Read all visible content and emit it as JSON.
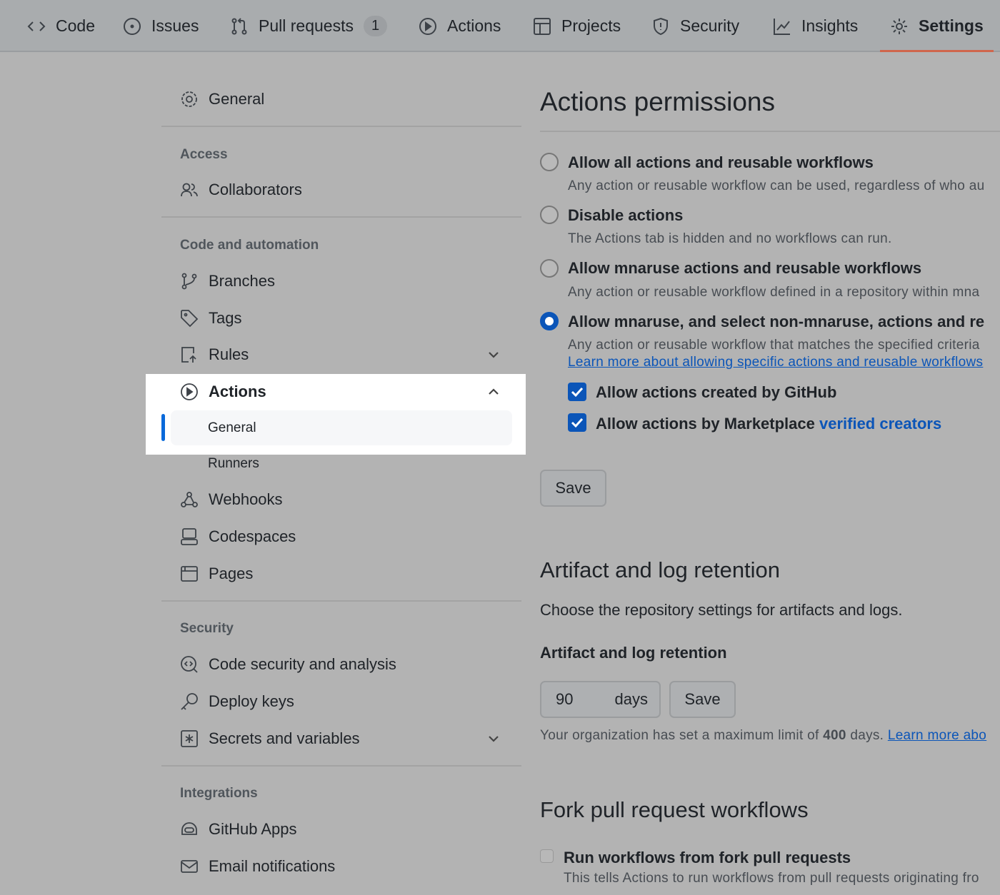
{
  "nav": {
    "tabs": [
      {
        "label": "Code",
        "icon": "code-icon"
      },
      {
        "label": "Issues",
        "icon": "issue-icon"
      },
      {
        "label": "Pull requests",
        "icon": "pull-request-icon",
        "count": "1"
      },
      {
        "label": "Actions",
        "icon": "play-icon"
      },
      {
        "label": "Projects",
        "icon": "table-icon"
      },
      {
        "label": "Security",
        "icon": "shield-icon"
      },
      {
        "label": "Insights",
        "icon": "graph-icon"
      },
      {
        "label": "Settings",
        "icon": "gear-icon",
        "selected": true
      }
    ]
  },
  "sidebar": {
    "general": "General",
    "access_heading": "Access",
    "collaborators": "Collaborators",
    "code_heading": "Code and automation",
    "branches": "Branches",
    "tags": "Tags",
    "rules": "Rules",
    "actions": "Actions",
    "actions_general": "General",
    "actions_runners": "Runners",
    "webhooks": "Webhooks",
    "codespaces": "Codespaces",
    "pages": "Pages",
    "security_heading": "Security",
    "code_security": "Code security and analysis",
    "deploy_keys": "Deploy keys",
    "secrets": "Secrets and variables",
    "integrations_heading": "Integrations",
    "github_apps": "GitHub Apps",
    "email": "Email notifications"
  },
  "main": {
    "permissions_title": "Actions permissions",
    "options": [
      {
        "label": "Allow all actions and reusable workflows",
        "desc": "Any action or reusable workflow can be used, regardless of who au",
        "selected": false
      },
      {
        "label": "Disable actions",
        "desc": "The Actions tab is hidden and no workflows can run.",
        "selected": false
      },
      {
        "label": "Allow mnaruse actions and reusable workflows",
        "desc": "Any action or reusable workflow defined in a repository within mna",
        "selected": false
      },
      {
        "label": "Allow mnaruse, and select non-mnaruse, actions and re",
        "desc": "Any action or reusable workflow that matches the specified criteria",
        "selected": true
      }
    ],
    "learn_more_link": "Learn more about allowing specific actions and reusable workflows",
    "check_github": "Allow actions created by GitHub",
    "check_marketplace": "Allow actions by Marketplace ",
    "verified_creators": "verified creators",
    "save": "Save",
    "retention_title": "Artifact and log retention",
    "retention_desc": "Choose the repository settings for artifacts and logs.",
    "retention_label": "Artifact and log retention",
    "retention_value": "90",
    "retention_unit": "days",
    "retention_note_pre": "Your organization has set a maximum limit of ",
    "retention_note_max": "400",
    "retention_note_post": " days. ",
    "retention_learn": "Learn more abo",
    "fork_title": "Fork pull request workflows",
    "fork_check": "Run workflows from fork pull requests",
    "fork_desc": "This tells Actions to run workflows from pull requests originating fro"
  },
  "colors": {
    "accent": "#0969da",
    "selected_tab_underline": "#fd8c73",
    "overlay": "#b3b3b3"
  }
}
